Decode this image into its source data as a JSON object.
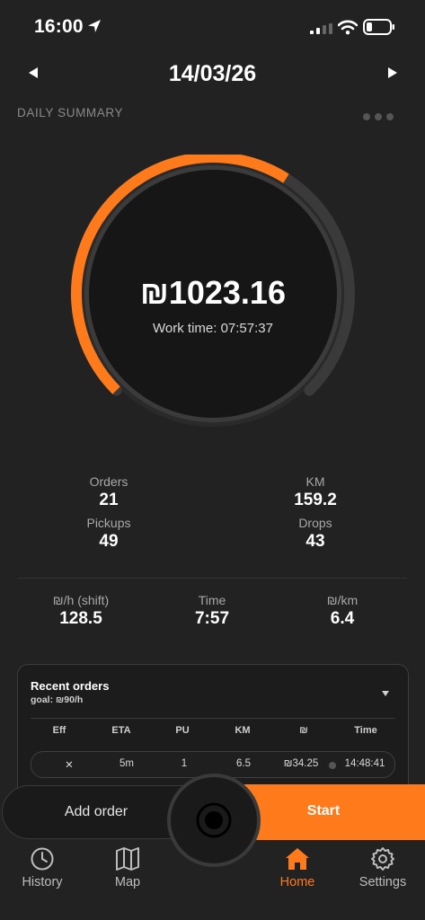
{
  "status_bar": {
    "time": "16:00"
  },
  "header": {
    "date": "14/03/26",
    "section_title": "DAILY SUMMARY"
  },
  "gauge": {
    "earnings": "₪1023.16",
    "work_time": "Work time: 07:57:37",
    "progress_fraction": 0.62,
    "accent": "#ff7a1a"
  },
  "stats": {
    "orders": {
      "label": "Orders",
      "value": "21"
    },
    "km": {
      "label": "KM",
      "value": "159.2"
    },
    "pickups": {
      "label": "Pickups",
      "value": "49"
    },
    "drops": {
      "label": "Drops",
      "value": "43"
    },
    "per_hour": {
      "label": "₪/h (shift)",
      "value": "128.5"
    },
    "time": {
      "label": "Time",
      "value": "7:57"
    },
    "per_km": {
      "label": "₪/km",
      "value": "6.4"
    }
  },
  "recent_orders": {
    "title": "Recent orders",
    "goal": "goal: ₪90/h",
    "columns": [
      "Eff",
      "ETA",
      "PU",
      "KM",
      "₪",
      "Time"
    ],
    "rows": [
      {
        "eff": "✕",
        "eta": "5m",
        "pu": "1",
        "km": "6.5",
        "amount": "₪34.25",
        "time": "14:48:41"
      }
    ]
  },
  "actions": {
    "add_order": "Add order",
    "start": "Start"
  },
  "tabs": [
    {
      "label": "History",
      "icon": "clock-icon"
    },
    {
      "label": "Map",
      "icon": "map-icon"
    },
    {
      "label": "Home",
      "icon": "home-icon",
      "active": true
    },
    {
      "label": "Settings",
      "icon": "gear-icon"
    }
  ]
}
